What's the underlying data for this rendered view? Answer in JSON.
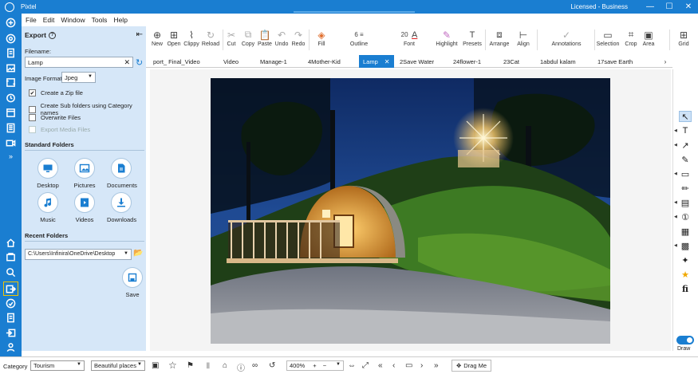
{
  "app": {
    "title": "Pixtel",
    "license": "Licensed - Business"
  },
  "window": {
    "minimize": "—",
    "maximize": "☐",
    "close": "✕"
  },
  "menu": [
    "File",
    "Edit",
    "Window",
    "Tools",
    "Help"
  ],
  "panel": {
    "title": "Export",
    "collapse_glyph": "⇤",
    "filename_label": "Filename:",
    "filename_value": "Lamp",
    "format_label": "Image Format:",
    "format_value": "Jpeg",
    "checkboxes": [
      {
        "label": "Create a Zip file",
        "checked": "✔",
        "disabled": false
      },
      {
        "label": "Create Sub folders using Category names",
        "checked": "",
        "disabled": false
      },
      {
        "label": "Overwrite Files",
        "checked": "",
        "disabled": false
      },
      {
        "label": "Export Media Files",
        "checked": "",
        "disabled": true
      }
    ],
    "standard_folders_title": "Standard Folders",
    "folders": [
      "Desktop",
      "Pictures",
      "Documents",
      "Music",
      "Videos",
      "Downloads"
    ],
    "recent_folders_title": "Recent Folders",
    "recent_path": "C:\\Users\\Infinira\\OneDrive\\Desktop",
    "save_label": "Save"
  },
  "toolbar": {
    "buttons": [
      {
        "label": "New",
        "icon": "plus-circle-icon",
        "glyph": "⊕"
      },
      {
        "label": "Open",
        "icon": "open-icon",
        "glyph": "⊞"
      },
      {
        "label": "Clippy",
        "icon": "clip-icon",
        "glyph": "⌇"
      },
      {
        "label": "Reload",
        "icon": "reload-icon",
        "glyph": "↻"
      },
      {
        "label": "Cut",
        "icon": "scissors-icon",
        "glyph": "✂"
      },
      {
        "label": "Copy",
        "icon": "copy-icon",
        "glyph": "⧉"
      },
      {
        "label": "Paste",
        "icon": "paste-icon",
        "glyph": "📋"
      },
      {
        "label": "Undo",
        "icon": "undo-icon",
        "glyph": "↶"
      },
      {
        "label": "Redo",
        "icon": "redo-icon",
        "glyph": "↷"
      },
      {
        "label": "Fill",
        "icon": "fill-icon",
        "glyph": "◈"
      },
      {
        "label": "Outline",
        "icon": "outline-icon",
        "glyph": "≡"
      },
      {
        "label": "Font",
        "icon": "font-icon",
        "glyph": "A"
      },
      {
        "label": "Highlight",
        "icon": "highlight-icon",
        "glyph": "✎"
      },
      {
        "label": "Presets",
        "icon": "presets-icon",
        "glyph": "T"
      },
      {
        "label": "Arrange",
        "icon": "arrange-icon",
        "glyph": "⧈"
      },
      {
        "label": "Align",
        "icon": "align-icon",
        "glyph": "⊢"
      },
      {
        "label": "Annotations",
        "icon": "annotations-icon",
        "glyph": "✓"
      },
      {
        "label": "Selection",
        "icon": "selection-icon",
        "glyph": "▭"
      },
      {
        "label": "Crop",
        "icon": "crop-icon",
        "glyph": "⌗"
      },
      {
        "label": "Area",
        "icon": "area-icon",
        "glyph": "▣"
      },
      {
        "label": "Grid",
        "icon": "grid-icon",
        "glyph": "⊞"
      }
    ],
    "outline_width": "6",
    "font_size": "20"
  },
  "tabs": [
    {
      "label": "port_ Final_Video",
      "active": false
    },
    {
      "label": "Video",
      "active": false
    },
    {
      "label": "Manage-1",
      "active": false
    },
    {
      "label": "4Mother-Kid",
      "active": false
    },
    {
      "label": "Lamp",
      "active": true
    },
    {
      "label": "2Save Water",
      "active": false
    },
    {
      "label": "24flower-1",
      "active": false
    },
    {
      "label": "23Cat",
      "active": false
    },
    {
      "label": "1abdul kalam",
      "active": false
    },
    {
      "label": "17save Earth",
      "active": false
    }
  ],
  "draw": {
    "label": "Draw"
  },
  "bottom": {
    "category_label": "Category",
    "category_value": "Tourism",
    "subcategory_value": "Beautiful places",
    "zoom": "400%",
    "drag_label": "Drag Me"
  },
  "colors": {
    "accent": "#1a7ed1",
    "panel": "#d6e7f8",
    "highlight_border": "#f3c400"
  }
}
